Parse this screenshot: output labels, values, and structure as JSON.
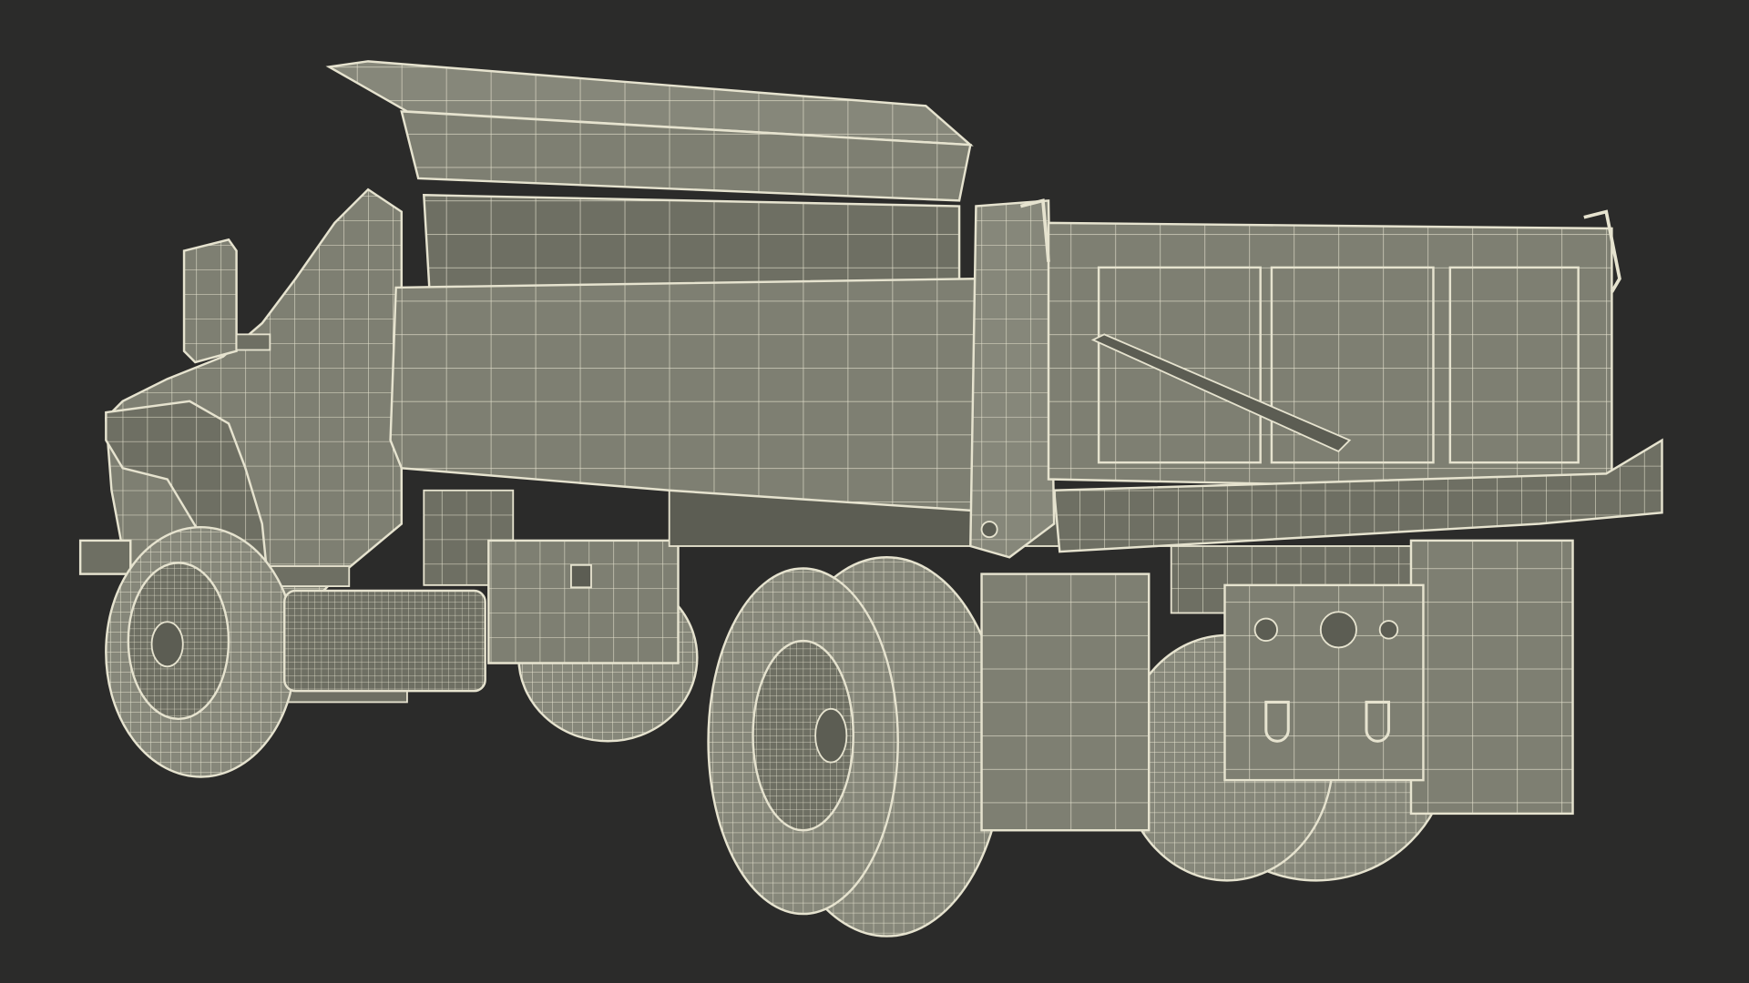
{
  "scene": {
    "background_color": "#2b2b2a",
    "body_color": "#7e7f72",
    "body_shade_color": "#6e6f63",
    "body_dark_color": "#5c5d53",
    "wire_color": "#e6e3cf",
    "tire_color": "#86877a",
    "icon": "dump-truck-wireframe-icon"
  }
}
